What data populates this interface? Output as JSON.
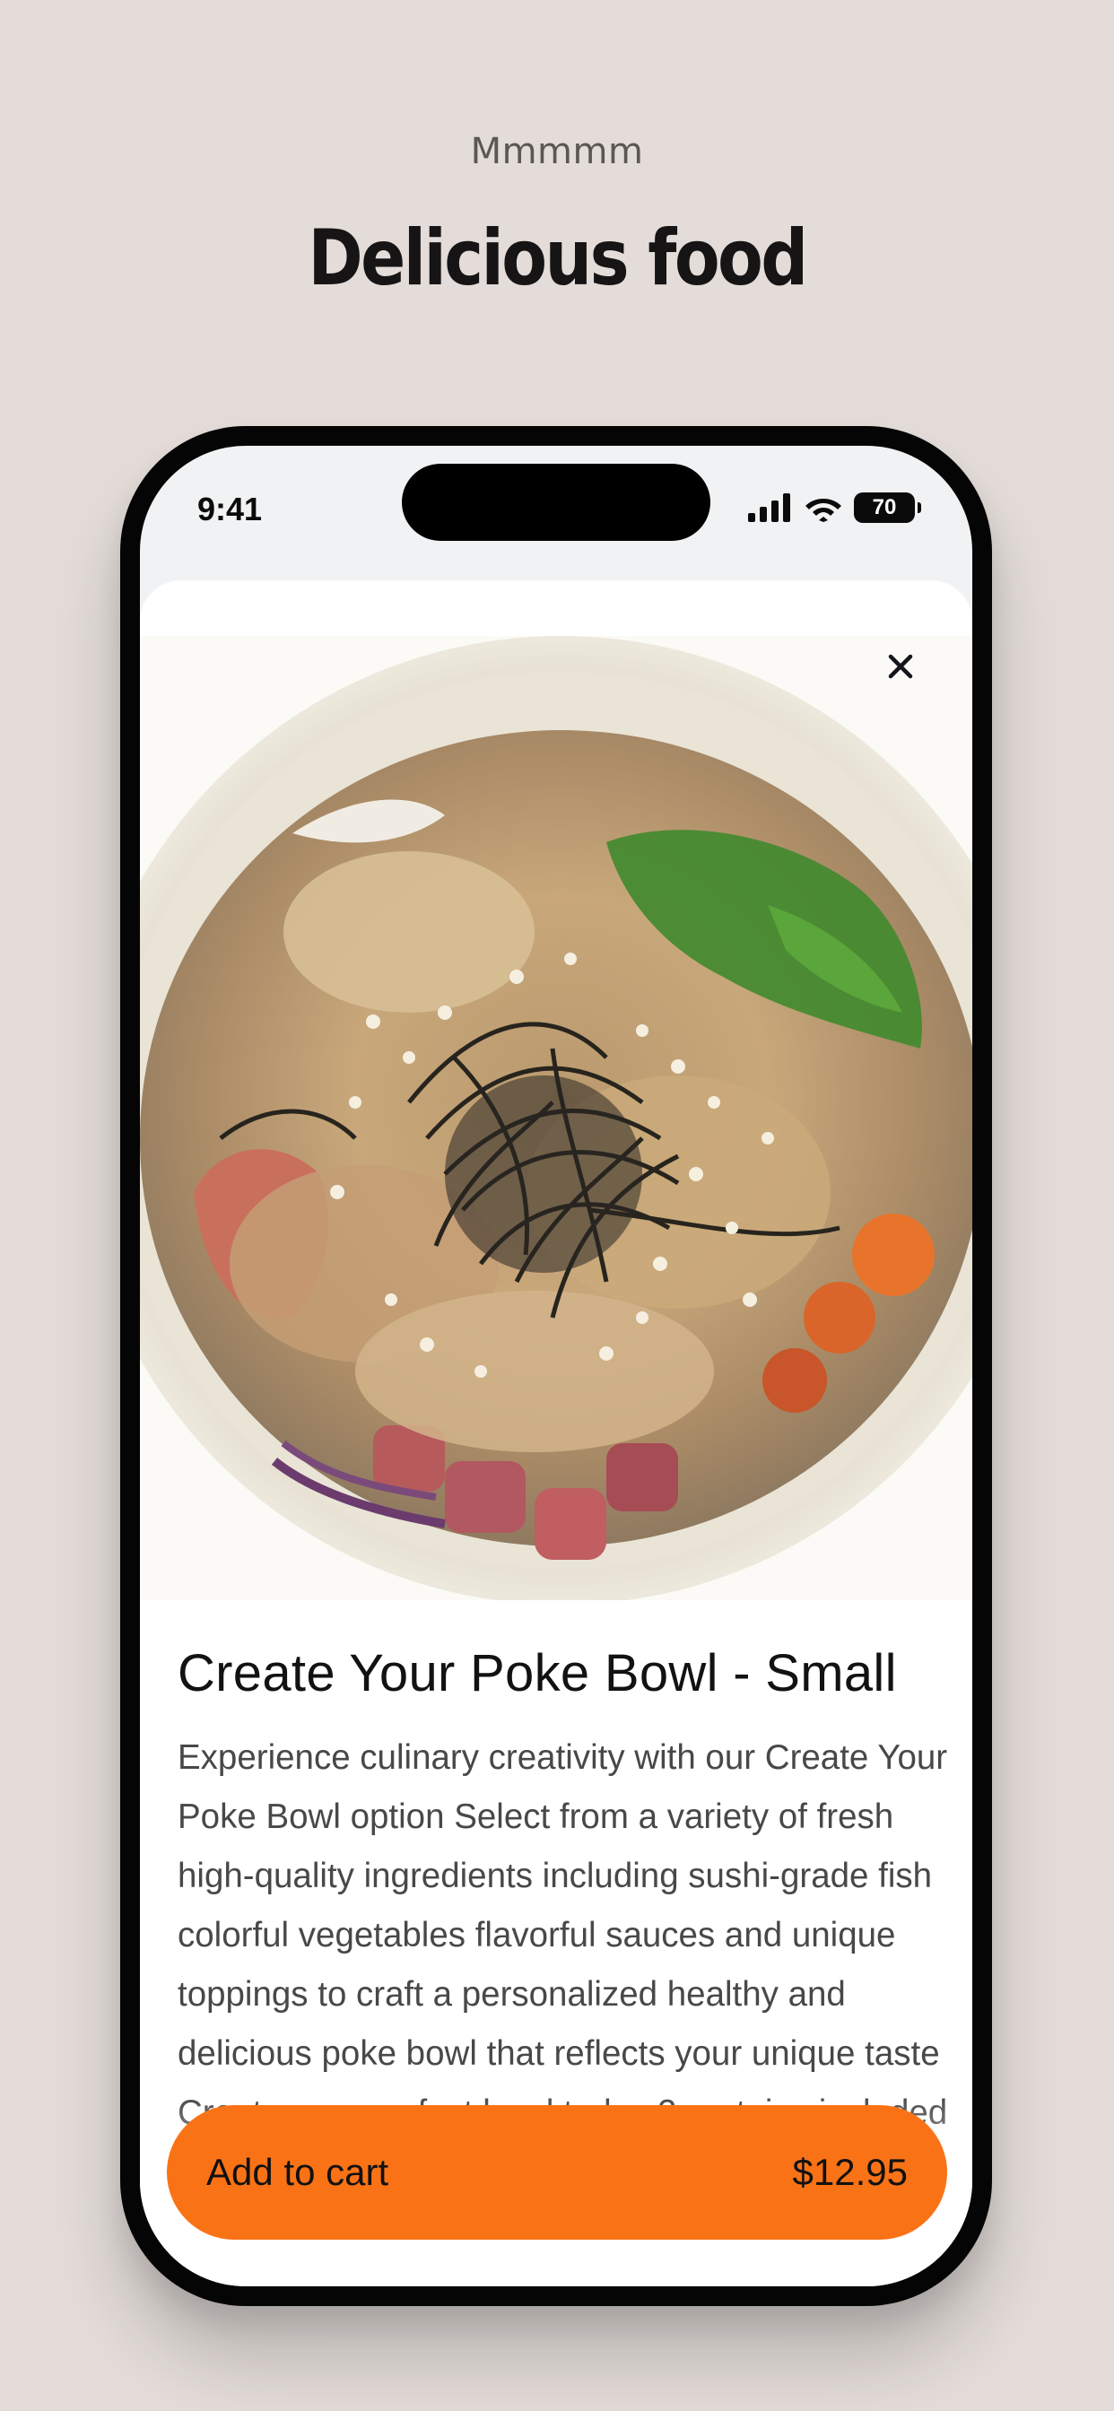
{
  "header": {
    "eyebrow": "Mmmmm",
    "headline": "Delicious food"
  },
  "status_bar": {
    "time": "9:41",
    "battery": "70"
  },
  "product": {
    "title": "Create Your Poke Bowl - Small",
    "description": "Experience culinary creativity with our Create Your Poke Bowl option Select from a variety of fresh high-quality ingredients including sushi-grade fish colorful vegetables flavorful sauces and unique toppings to craft a personalized healthy and delicious poke bowl that reflects your unique taste Create your perfect bowl today 2 proteins included"
  },
  "cart": {
    "label": "Add to cart",
    "price": "$12.95",
    "color": "#f97316"
  },
  "colors": {
    "background": "#e3dcd9",
    "phone_frame": "#050505",
    "accent": "#f97316"
  },
  "icons": [
    "signal-icon",
    "wifi-icon",
    "battery-icon",
    "close-icon"
  ]
}
